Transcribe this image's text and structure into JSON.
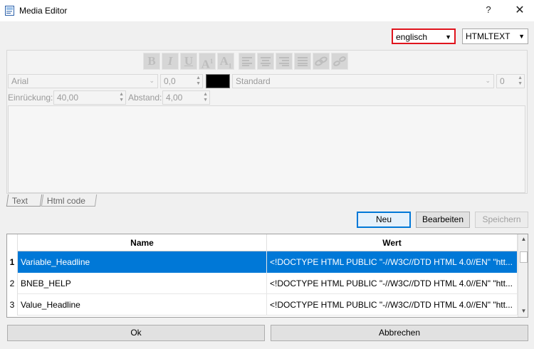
{
  "window": {
    "title": "Media Editor",
    "help": "?",
    "close": "✕"
  },
  "language_combo": {
    "value": "englisch"
  },
  "format_combo": {
    "value": "HTMLTEXT"
  },
  "toolbar": {
    "buttons": [
      "bold-icon",
      "italic-icon",
      "underline-icon",
      "superscript-icon",
      "subscript-icon",
      "align-left-icon",
      "align-center-icon",
      "align-right-icon",
      "justify-icon",
      "link-icon",
      "unlink-icon"
    ]
  },
  "font_row": {
    "font": "Arial",
    "size": "0,0",
    "color": "#000000",
    "style": "Standard",
    "num": "0"
  },
  "indent_row": {
    "indent_label": "Einrückung:",
    "indent_value": "40,00",
    "spacing_label": "Abstand:",
    "spacing_value": "4,00"
  },
  "tabs": {
    "text": "Text",
    "html": "Html code"
  },
  "buttons": {
    "new": "Neu",
    "edit": "Bearbeiten",
    "save": "Speichern",
    "ok": "Ok",
    "cancel": "Abbrechen"
  },
  "table": {
    "columns": [
      "Name",
      "Wert"
    ],
    "rows": [
      {
        "num": "1",
        "name": "Variable_Headline",
        "value": "<!DOCTYPE HTML PUBLIC \"-//W3C//DTD HTML 4.0//EN\" \"htt...",
        "selected": true
      },
      {
        "num": "2",
        "name": "BNEB_HELP",
        "value": "<!DOCTYPE HTML PUBLIC \"-//W3C//DTD HTML 4.0//EN\" \"htt...",
        "selected": false
      },
      {
        "num": "3",
        "name": "Value_Headline",
        "value": "<!DOCTYPE HTML PUBLIC \"-//W3C//DTD HTML 4.0//EN\" \"htt...",
        "selected": false
      }
    ]
  },
  "colors": {
    "accent": "#0078d7",
    "highlight_border": "#e0141d"
  }
}
